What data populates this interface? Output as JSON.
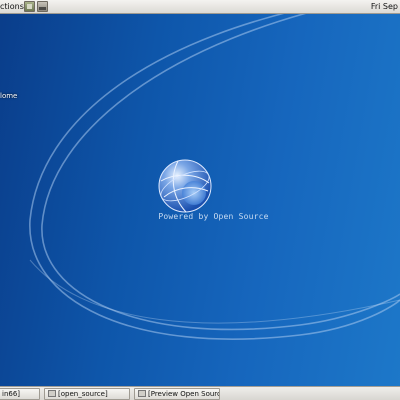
{
  "top_panel": {
    "menu_label": "ctions",
    "clock": "Fri Sep"
  },
  "desktop": {
    "icon_label": "lome",
    "logo_caption": "Powered by Open Source"
  },
  "taskbar": {
    "tasks": [
      {
        "label": "in66]"
      },
      {
        "label": "[open_source]"
      },
      {
        "label": "[Preview Open Source"
      }
    ]
  },
  "colors": {
    "desktop_dark": "#0a3d8a",
    "desktop_light": "#1d78c9",
    "panel": "#dcdad5"
  }
}
